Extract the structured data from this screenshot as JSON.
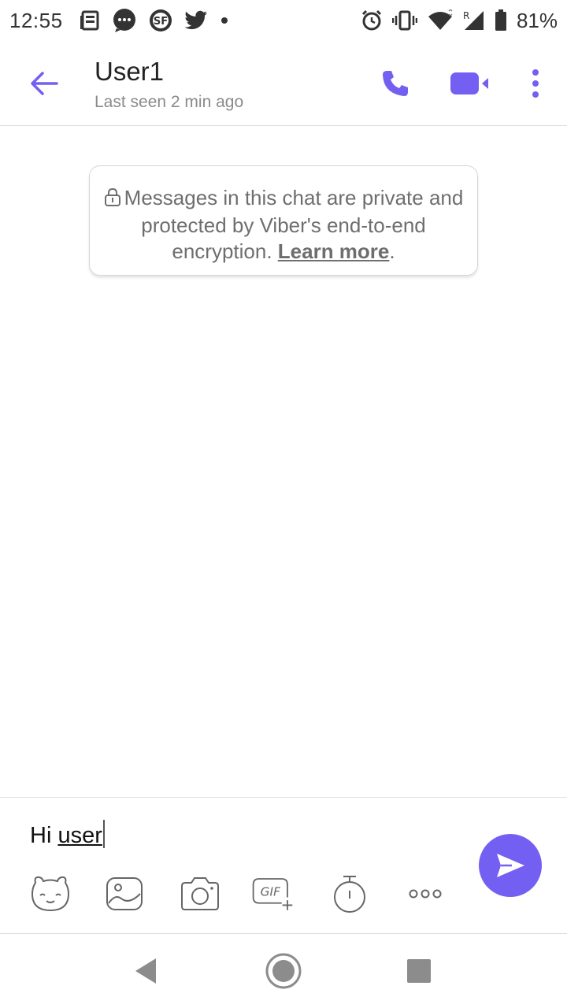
{
  "status_bar": {
    "time": "12:55",
    "battery": "81%",
    "left_icons": [
      "news-icon",
      "messages-icon",
      "sf-app-icon",
      "twitter-icon",
      "dot-icon"
    ],
    "right_icons": [
      "alarm-icon",
      "vibrate-icon",
      "wifi-icon",
      "signal-icon",
      "battery-icon"
    ]
  },
  "header": {
    "contact_name": "User1",
    "last_seen": "Last seen 2 min ago",
    "accent_color": "#7360f2"
  },
  "notice": {
    "text": "Messages in this chat are private and protected by Viber's end-to-end encryption.",
    "link": "Learn more",
    "suffix": "."
  },
  "composer": {
    "message_prefix": "Hi ",
    "message_word": "user",
    "tools": [
      "sticker-icon",
      "gallery-icon",
      "camera-icon",
      "gif-icon",
      "timer-icon",
      "more-options-icon"
    ],
    "gif_label": "GIF"
  },
  "nav": {
    "buttons": [
      "back-triangle-icon",
      "home-circle-icon",
      "recents-square-icon"
    ]
  }
}
